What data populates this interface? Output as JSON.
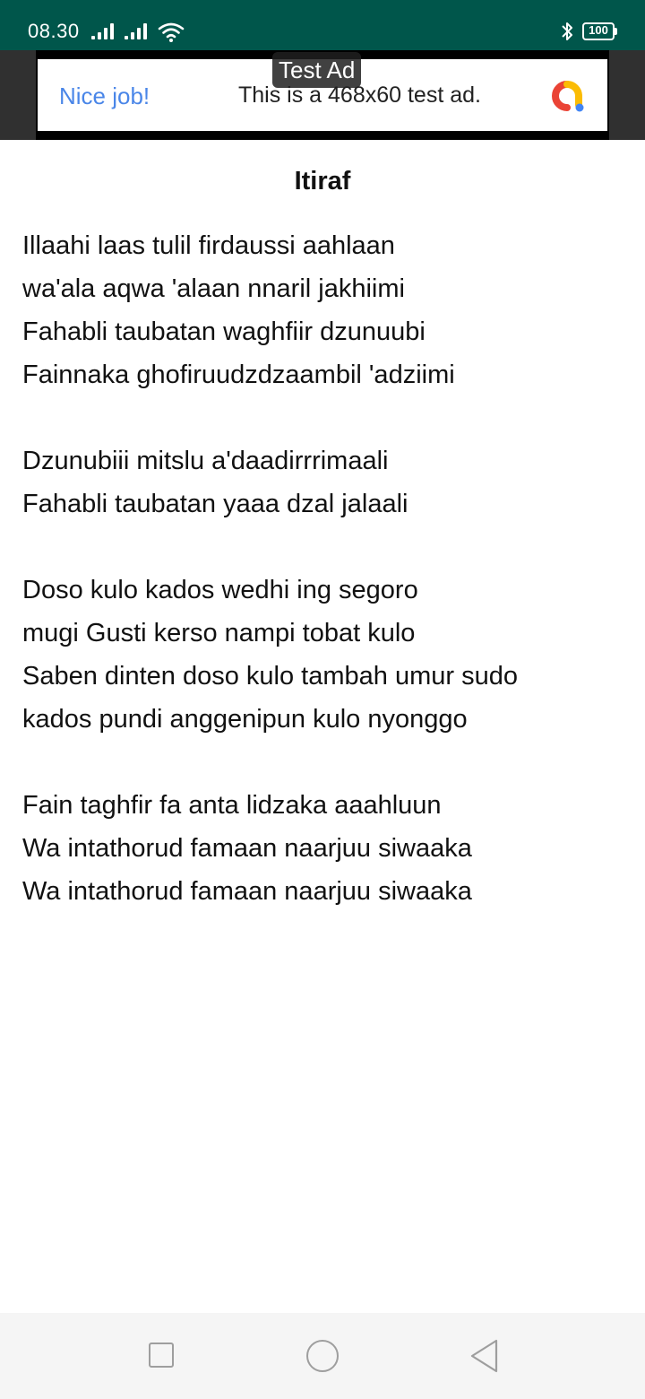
{
  "status_bar": {
    "time": "08.30",
    "battery": "100"
  },
  "ad": {
    "badge": "Test Ad",
    "headline": "Nice job!",
    "body": "This is a 468x60 test ad."
  },
  "song": {
    "title": "Itiraf",
    "lines": [
      "Illaahi laas tulil firdaussi aahlaan",
      "wa'ala aqwa 'alaan nnaril jakhiimi",
      "Fahabli taubatan waghfiir dzunuubi",
      "Fainnaka ghofiruudzdzaambil 'adziimi",
      "Dzunubiii mitslu a'daadirrrimaali",
      "Fahabli taubatan yaaa dzal jalaali",
      "Doso kulo kados wedhi ing segoro",
      "mugi Gusti kerso nampi tobat kulo",
      "Saben dinten doso kulo tambah umur sudo",
      "kados pundi anggenipun kulo nyonggo",
      "Fain taghfir fa anta lidzaka aaahluun",
      "Wa intathorud famaan naarjuu siwaaka",
      "Wa intathorud famaan naarjuu siwaaka"
    ]
  },
  "nav": {
    "recents_icon": "square-icon",
    "home_icon": "circle-icon",
    "back_icon": "triangle-back-icon"
  },
  "colors": {
    "status_bar": "#00564b",
    "ad_headline": "#4a86e8",
    "nav_bar": "#f5f5f5"
  }
}
